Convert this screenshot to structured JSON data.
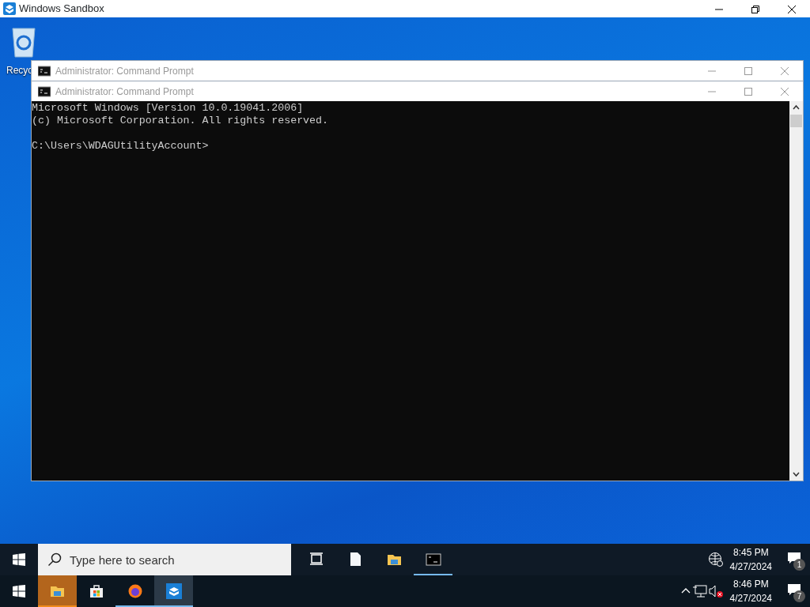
{
  "host_window": {
    "title": "Windows Sandbox"
  },
  "desktop_icons": [
    {
      "label": "Recyc"
    }
  ],
  "windows": [
    {
      "title": "Administrator: Command Prompt"
    },
    {
      "title": "Administrator: Command Prompt",
      "console": {
        "banner": [
          "Microsoft Windows [Version 10.0.19041.2006]",
          "(c) Microsoft Corporation. All rights reserved."
        ],
        "prompt": "C:\\Users\\WDAGUtilityAccount>"
      }
    }
  ],
  "inner_taskbar": {
    "search": {
      "placeholder": "Type here to search"
    },
    "apps": [
      {
        "kind": "taskview",
        "running": false
      },
      {
        "kind": "file",
        "running": false
      },
      {
        "kind": "folder",
        "running": false
      },
      {
        "kind": "console",
        "running": true
      }
    ],
    "clock": {
      "time": "8:45 PM",
      "date": "4/27/2024"
    },
    "notifications": "1"
  },
  "host_taskbar": {
    "apps": [
      {
        "kind": "folder",
        "running": true,
        "flashing": true,
        "active": false
      },
      {
        "kind": "store",
        "running": false,
        "flashing": false,
        "active": false
      },
      {
        "kind": "browser",
        "running": true,
        "flashing": false,
        "active": false
      },
      {
        "kind": "sandbox",
        "running": true,
        "flashing": false,
        "active": true
      }
    ],
    "clock": {
      "time": "8:46 PM",
      "date": "4/27/2024"
    },
    "notifications": "7"
  }
}
